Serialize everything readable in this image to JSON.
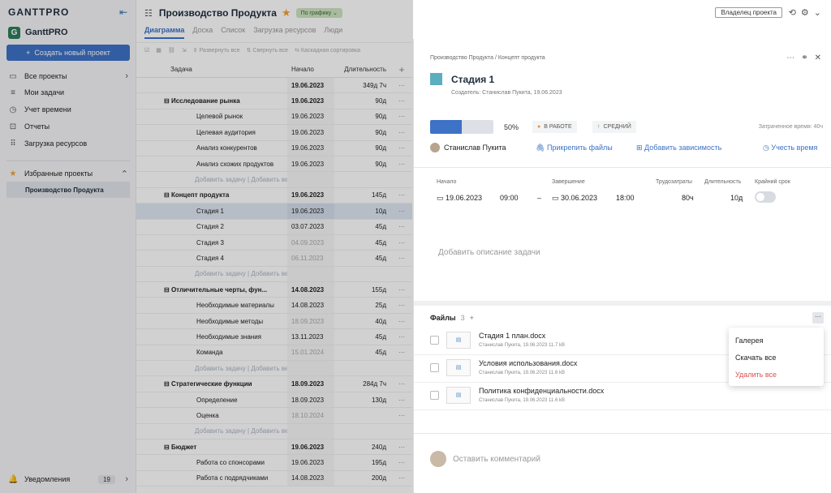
{
  "sidebar": {
    "logo": "GANTTPRO",
    "workspace_badge": "G",
    "workspace": "GanttPRO",
    "create": "Создать новый проект",
    "nav": [
      {
        "icon": "▭",
        "label": "Все проекты"
      },
      {
        "icon": "≡",
        "label": "Мои задачи"
      },
      {
        "icon": "◷",
        "label": "Учет времени"
      },
      {
        "icon": "⊡",
        "label": "Отчеты"
      },
      {
        "icon": "⠿",
        "label": "Загрузка ресурсов"
      }
    ],
    "favorites": "Избранные проекты",
    "fav_item": "Производство Продукта",
    "notifications": "Уведомления",
    "notif_count": "19"
  },
  "header": {
    "title": "Производство Продукта",
    "schedule": "По графику",
    "owner": "Владелец проекта"
  },
  "tabs": [
    "Диаграмма",
    "Доска",
    "Список",
    "Загрузка ресурсов",
    "Люди"
  ],
  "toolbar": {
    "expand": "Развернуть все",
    "collapse": "Свернуть все",
    "cascade": "Каскадная сортировка"
  },
  "grid": {
    "headers": {
      "task": "Задача",
      "start": "Начало",
      "duration": "Длительность"
    },
    "rows": [
      {
        "name": "",
        "start": "19.06.2023",
        "dur": "349д 7ч",
        "type": "total"
      },
      {
        "name": "Исследование рынка",
        "start": "19.06.2023",
        "dur": "90д",
        "type": "group"
      },
      {
        "name": "Целевой рынок",
        "start": "19.06.2023",
        "dur": "90д",
        "type": "task"
      },
      {
        "name": "Целевая аудитория",
        "start": "19.06.2023",
        "dur": "90д",
        "type": "task"
      },
      {
        "name": "Анализ конкурентов",
        "start": "19.06.2023",
        "dur": "90д",
        "type": "task"
      },
      {
        "name": "Анализ схожих продуктов",
        "start": "19.06.2023",
        "dur": "90д",
        "type": "task"
      },
      {
        "name": "Добавить задачу | Добавить веху",
        "start": "",
        "dur": "",
        "type": "add"
      },
      {
        "name": "Концепт продукта",
        "start": "19.06.2023",
        "dur": "145д",
        "type": "group"
      },
      {
        "name": "Стадия 1",
        "start": "19.06.2023",
        "dur": "10д",
        "type": "sel"
      },
      {
        "name": "Стадия 2",
        "start": "03.07.2023",
        "dur": "45д",
        "type": "task"
      },
      {
        "name": "Стадия 3",
        "start": "04.09.2023",
        "dur": "45д",
        "type": "task"
      },
      {
        "name": "Стадия 4",
        "start": "06.11.2023",
        "dur": "45д",
        "type": "task"
      },
      {
        "name": "Добавить задачу | Добавить веху",
        "start": "",
        "dur": "",
        "type": "add"
      },
      {
        "name": "Отличительные черты, фун...",
        "start": "14.08.2023",
        "dur": "155д",
        "type": "group"
      },
      {
        "name": "Необходимые материалы",
        "start": "14.08.2023",
        "dur": "25д",
        "type": "task"
      },
      {
        "name": "Необходимые методы",
        "start": "18.09.2023",
        "dur": "40д",
        "type": "task"
      },
      {
        "name": "Необходимые знания",
        "start": "13.11.2023",
        "dur": "45д",
        "type": "task"
      },
      {
        "name": "Команда",
        "start": "15.01.2024",
        "dur": "45д",
        "type": "task"
      },
      {
        "name": "Добавить задачу | Добавить веху",
        "start": "",
        "dur": "",
        "type": "add"
      },
      {
        "name": "Стратегические функции",
        "start": "18.09.2023",
        "dur": "284д 7ч",
        "type": "group"
      },
      {
        "name": "Определение",
        "start": "18.09.2023",
        "dur": "130д",
        "type": "task"
      },
      {
        "name": "Оценка",
        "start": "18.10.2024",
        "dur": "",
        "type": "task"
      },
      {
        "name": "Добавить задачу | Добавить веху",
        "start": "",
        "dur": "",
        "type": "add"
      },
      {
        "name": "Бюджет",
        "start": "19.06.2023",
        "dur": "240д",
        "type": "group"
      },
      {
        "name": "Работа со спонсорами",
        "start": "19.06.2023",
        "dur": "195д",
        "type": "task"
      },
      {
        "name": "Работа с подрядчиками",
        "start": "14.08.2023",
        "dur": "200д",
        "type": "task"
      }
    ]
  },
  "panel": {
    "breadcrumb": "Производство Продукта / Концепт продукта",
    "title": "Стадия 1",
    "creator": "Создатель: Станислав Пукита, 19.06.2023",
    "progress": 0.5,
    "percent": "50%",
    "status": "В РАБОТЕ",
    "priority": "СРЕДНИЙ",
    "spent": "Затраченное время: 40ч",
    "assignee": "Станислав Пукита",
    "attach": "Прикрепить файлы",
    "dependency": "Добавить зависимость",
    "track": "Учесть время",
    "labels": {
      "start": "Начало",
      "end": "Завершение",
      "effort": "Трудозатраты",
      "duration": "Длительность",
      "deadline": "Крайний срок"
    },
    "start_date": "19.06.2023",
    "start_time": "09:00",
    "end_date": "30.06.2023",
    "end_time": "18:00",
    "effort": "80ч",
    "duration": "10д",
    "description": "Добавить описание задачи",
    "files_title": "Файлы",
    "files_count": "3",
    "files": [
      {
        "name": "Стадия 1 план.docx",
        "meta": "Станислав Пукита, 19.06.2023 11.7 kB"
      },
      {
        "name": "Условия использования.docx",
        "meta": "Станислав Пукита, 19.06.2023 11.6 kB"
      },
      {
        "name": "Политика конфиденциальности.docx",
        "meta": "Станислав Пукита, 19.06.2023 11.6 kB"
      }
    ],
    "menu": [
      "Галерея",
      "Скачать все",
      "Удалить все"
    ],
    "comment": "Оставить комментарий"
  }
}
